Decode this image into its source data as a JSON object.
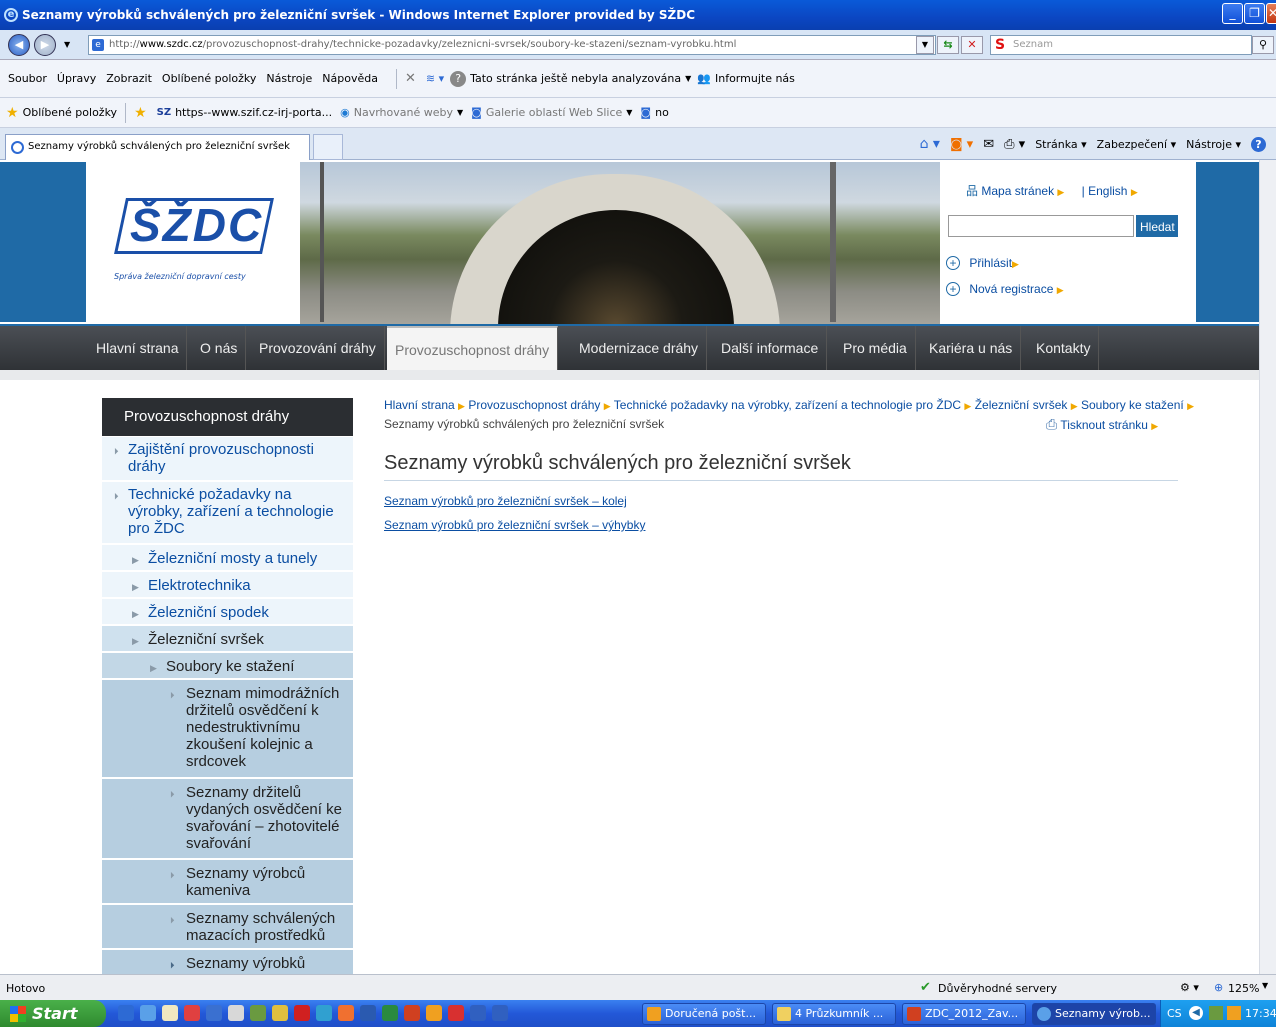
{
  "window": {
    "title": "Seznamy výrobků schválených pro železniční svršek - Windows Internet Explorer provided by SŽDC"
  },
  "address": {
    "prefix": "http://",
    "domain": "www.szdc.cz",
    "path": "/provozuschopnost-drahy/technicke-pozadavky/zeleznicni-svrsek/soubory-ke-stazeni/seznam-vyrobku.html"
  },
  "search": {
    "placeholder": "Seznam",
    "logo": "S"
  },
  "menubar": {
    "items": [
      "Soubor",
      "Úpravy",
      "Zobrazit",
      "Oblíbené položky",
      "Nástroje",
      "Nápověda"
    ],
    "analyze": "Tato stránka ještě nebyla analyzována",
    "inform": "Informujte nás"
  },
  "favbar": {
    "label": "Oblíbené položky",
    "items": [
      "https--www.szif.cz-irj-porta...",
      "Navrhované weby",
      "Galerie oblastí Web Slice",
      "no"
    ]
  },
  "tab": {
    "title": "Seznamy výrobků schválených pro železniční svršek"
  },
  "cmdbar": {
    "items": [
      "Stránka",
      "Zabezpečení",
      "Nástroje"
    ]
  },
  "header": {
    "logo_text": "ŠŽDC",
    "logo_sub": "Správa železniční dopravní cesty",
    "sitemap": "Mapa stránek",
    "english": "| English",
    "search_button": "Hledat",
    "login": "Přihlásit",
    "register": "Nová registrace"
  },
  "nav": {
    "items": [
      "Hlavní strana",
      "O nás",
      "Provozování dráhy",
      "Provozuschopnost dráhy",
      "Modernizace dráhy",
      "Další informace",
      "Pro média",
      "Kariéra u nás",
      "Kontakty"
    ]
  },
  "leftmenu": {
    "title": "Provozuschopnost dráhy",
    "items": [
      "Zajištění provozuschopnosti dráhy",
      "Technické požadavky na výrobky, zařízení a technologie pro ŽDC",
      "Železniční mosty a tunely",
      "Elektrotechnika",
      "Železniční spodek",
      "Železniční svršek",
      "Soubory ke stažení",
      "Seznam mimodrážních držitelů osvědčení k nedestruktivnímu zkoušení kolejnic a srdcovek",
      "Seznamy držitelů vydaných osvědčení ke svařování – zhotovitelé svařování",
      "Seznamy výrobců kameniva",
      "Seznamy schválených mazacích prostředků",
      "Seznamy výrobků schválených"
    ]
  },
  "breadcrumb": {
    "items": [
      "Hlavní strana",
      "Provozuschopnost dráhy",
      "Technické požadavky na výrobky, zařízení a technologie pro ŽDC",
      "Železniční svršek",
      "Soubory ke stažení"
    ],
    "current": "Seznamy výrobků schválených pro železniční svršek"
  },
  "print": "Tisknout stránku",
  "content": {
    "heading": "Seznamy výrobků schválených pro železniční svršek",
    "links": [
      "Seznam výrobků pro železniční svršek – kolej",
      "Seznam výrobků pro železniční svršek – výhybky"
    ]
  },
  "status": {
    "left": "Hotovo",
    "zone": "Důvěryhodné servery",
    "zoom": "125%"
  },
  "taskbar": {
    "start": "Start",
    "tasks": [
      "Doručená pošt...",
      "4 Průzkumník ...",
      "ZDC_2012_Zav...",
      "Seznamy výrob..."
    ],
    "lang": "CS",
    "time": "17:34"
  },
  "colors": {
    "accent": "#1f6aa6",
    "nav": "#2f3236",
    "link": "#0b4ea2"
  }
}
